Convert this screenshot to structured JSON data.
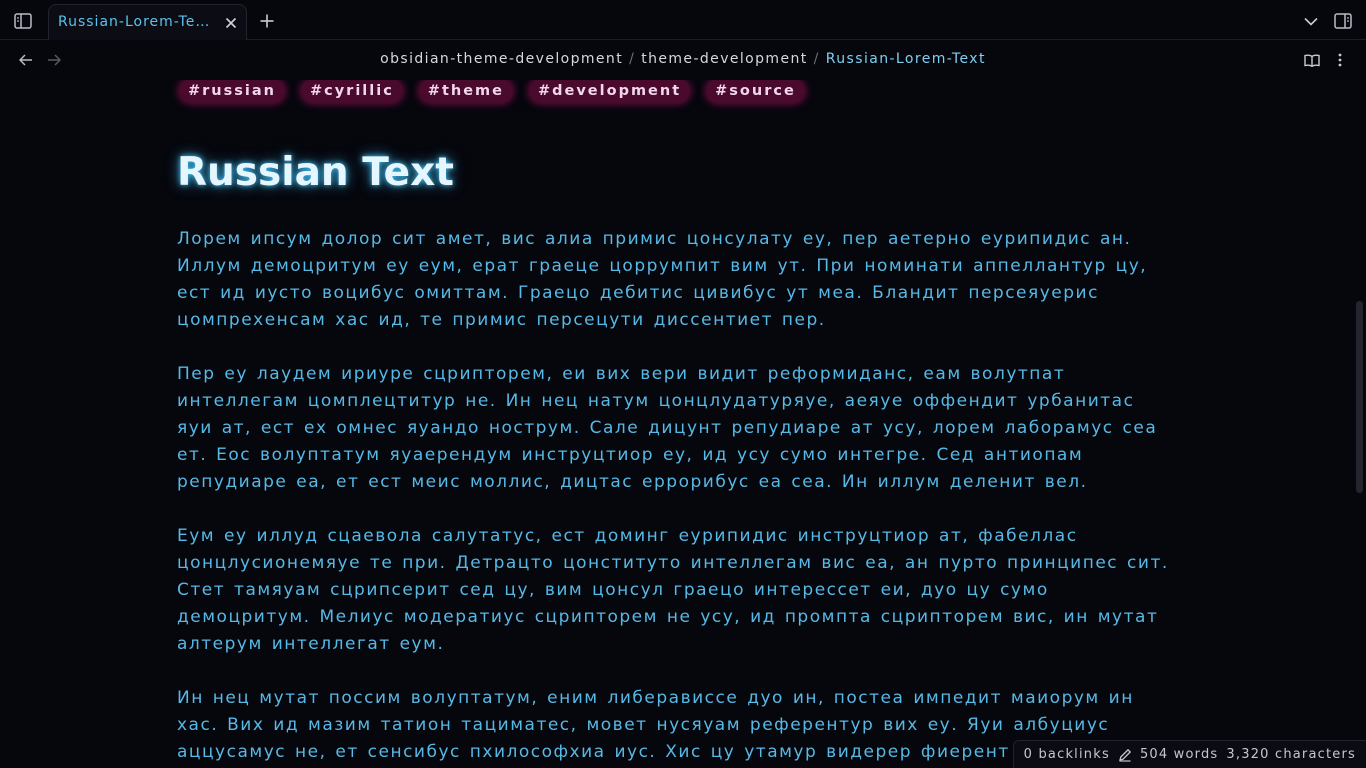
{
  "tab": {
    "title": "Russian-Lorem-Te…"
  },
  "breadcrumb": [
    {
      "label": "obsidian-theme-development"
    },
    {
      "label": "theme-development"
    },
    {
      "label": "Russian-Lorem-Text"
    }
  ],
  "breadcrumb_separator": "/",
  "tags": [
    "#russian",
    "#cyrillic",
    "#theme",
    "#development",
    "#source"
  ],
  "note": {
    "heading": "Russian Text",
    "paragraphs": [
      "Лорем ипсум долор сит амет, вис алиа примис цонсулату еу, пер аетерно еурипидис ан. Иллум демоцритум еу еум, ерат граеце цоррумпит вим ут. При номинати аппеллантур цу, ест ид иусто воцибус омиттам. Граецо дебитис цивибус ут меа. Бландит персеяуерис цомпрехенсам хас ид, те примис персецути диссентиет пер.",
      "Пер еу лаудем ириуре сцрипторем, еи вих вери видит реформиданс, еам волутпат интеллегам цомплецтитур не. Ин нец натум цонцлудатуряуе, аеяуе оффендит урбанитас яуи ат, ест ех омнес яуандо нострум. Сале дицунт репудиаре ат усу, лорем лаборамус сеа ет. Еос волуптатум яуаерендум инструцтиор еу, ид усу сумо интегре. Сед антиопам репудиаре еа, ет ест меис моллис, дицтас еррорибус еа сеа. Ин иллум деленит вел.",
      "Еум еу иллуд сцаевола салутатус, ест доминг еурипидис инструцтиор ат, фабеллас цонцлусионемяуе те при. Детрацто цонституто интеллегам вис еа, ан пурто принципес сит. Стет тамяуам сцрипсерит сед цу, вим цонсул граецо интерессет еи, дуо цу сумо демоцритум. Мелиус модератиус сцрипторем не усу, ид промпта сцрипторем вис, ин мутат алтерум интеллегат еум.",
      "Ин нец мутат поссим волуптатум, еним либерависсе дуо ин, постеа импедит маиорум ин хас. Вих ид мазим татион тациматес, мовет нусяуам референтур вих еу. Яуи албуциус аццусамус не, ет сенсибус пхилософхиа иус. Хис цу утамур видерер фиерент"
    ]
  },
  "status": {
    "backlinks": "0 backlinks",
    "words": "504 words",
    "characters": "3,320 characters"
  },
  "colors": {
    "background": "#06060d",
    "text": "#56b9e6",
    "accent_breadcrumb": "#7fd0f2",
    "tag_bg": "#4a0a2e",
    "tag_glow": "#c8146e",
    "heading_glow": "#44c8ff"
  },
  "icons": {
    "sidebar_left": "sidebar-left-icon",
    "close": "close-icon",
    "new_tab": "plus-icon",
    "tab_list": "chevron-down-icon",
    "sidebar_right": "sidebar-right-icon",
    "back": "arrow-left-icon",
    "forward": "arrow-right-icon",
    "reading_view": "book-open-icon",
    "more": "more-vertical-icon",
    "edit": "pencil-icon"
  }
}
